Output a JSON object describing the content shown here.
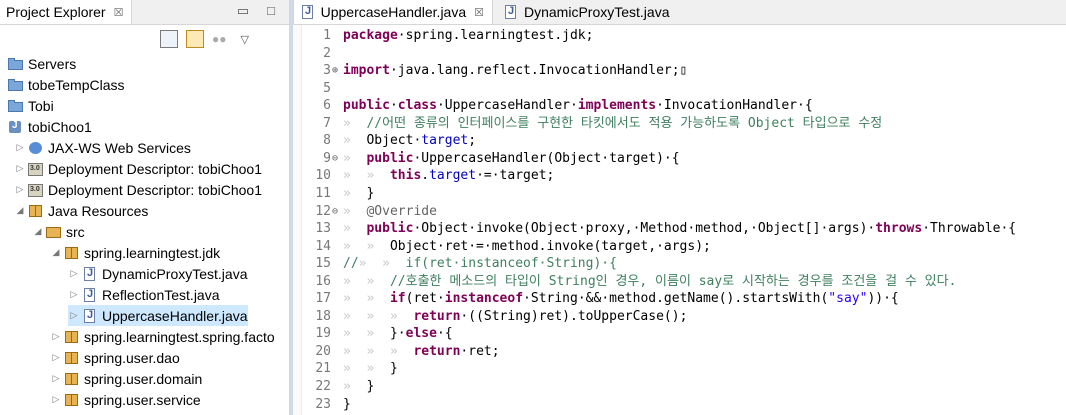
{
  "project_explorer": {
    "tab_title": "Project Explorer",
    "close_glyph": "☒",
    "minimize_glyph": "▭",
    "maximize_glyph": "□",
    "tree": [
      {
        "label": "Servers",
        "icon": "folder-icon",
        "indent": 0,
        "toggle": ""
      },
      {
        "label": "tobeTempClass",
        "icon": "folder-icon",
        "indent": 0,
        "toggle": ""
      },
      {
        "label": "Tobi",
        "icon": "folder-icon",
        "indent": 0,
        "toggle": ""
      },
      {
        "label": "tobiChoo1",
        "icon": "project-icon",
        "indent": 0,
        "toggle": ""
      },
      {
        "label": "JAX-WS Web Services",
        "icon": "web-services-icon",
        "indent": 1,
        "toggle": "▷"
      },
      {
        "label": "Deployment Descriptor: tobiChoo1",
        "icon": "deployment-descriptor-icon",
        "indent": 1,
        "toggle": "▷"
      },
      {
        "label": "Deployment Descriptor: tobiChoo1",
        "icon": "deployment-descriptor-icon",
        "indent": 1,
        "toggle": "▷"
      },
      {
        "label": "Java Resources",
        "icon": "java-resources-icon",
        "indent": 1,
        "toggle": "◢"
      },
      {
        "label": "src",
        "icon": "source-folder-icon",
        "indent": 2,
        "toggle": "◢"
      },
      {
        "label": "spring.learningtest.jdk",
        "icon": "package-icon",
        "indent": 3,
        "toggle": "◢"
      },
      {
        "label": "DynamicProxyTest.java",
        "icon": "java-file-icon",
        "indent": 4,
        "toggle": "▷"
      },
      {
        "label": "ReflectionTest.java",
        "icon": "java-file-icon",
        "indent": 4,
        "toggle": "▷"
      },
      {
        "label": "UppercaseHandler.java",
        "icon": "java-file-icon",
        "indent": 4,
        "toggle": "▷",
        "selected": true
      },
      {
        "label": "spring.learningtest.spring.facto",
        "icon": "package-icon",
        "indent": 3,
        "toggle": "▷"
      },
      {
        "label": "spring.user.dao",
        "icon": "package-icon",
        "indent": 3,
        "toggle": "▷"
      },
      {
        "label": "spring.user.domain",
        "icon": "package-icon",
        "indent": 3,
        "toggle": "▷"
      },
      {
        "label": "spring.user.service",
        "icon": "package-icon",
        "indent": 3,
        "toggle": "▷"
      }
    ]
  },
  "editor": {
    "tabs": [
      {
        "label": "UppercaseHandler.java",
        "active": true,
        "close_glyph": "☒"
      },
      {
        "label": "DynamicProxyTest.java",
        "active": false
      }
    ],
    "lines": [
      {
        "n": "1",
        "fold": "",
        "segs": [
          [
            "kw",
            "package"
          ],
          [
            "",
            "·spring.learningtest.jdk;"
          ]
        ]
      },
      {
        "n": "2",
        "fold": "",
        "segs": []
      },
      {
        "n": "3",
        "fold": "⊕",
        "segs": [
          [
            "kw",
            "import"
          ],
          [
            "",
            "·java.lang.reflect.InvocationHandler;▯"
          ]
        ]
      },
      {
        "n": "5",
        "fold": "",
        "segs": []
      },
      {
        "n": "6",
        "fold": "",
        "segs": [
          [
            "kw",
            "public"
          ],
          [
            "",
            "·"
          ],
          [
            "kw",
            "class"
          ],
          [
            "",
            "·UppercaseHandler·"
          ],
          [
            "kw",
            "implements"
          ],
          [
            "",
            "·InvocationHandler·{"
          ]
        ]
      },
      {
        "n": "7",
        "fold": "",
        "segs": [
          [
            "ws",
            "»  "
          ],
          [
            "cm",
            "//어떤 종류의 인터페이스를 구현한 타킷에서도 적용 가능하도록 Object 타입으로 수정"
          ]
        ]
      },
      {
        "n": "8",
        "fold": "",
        "segs": [
          [
            "ws",
            "»  "
          ],
          [
            "",
            "Object·"
          ],
          [
            "fld",
            "target"
          ],
          [
            "",
            ";"
          ]
        ]
      },
      {
        "n": "9",
        "fold": "⊖",
        "segs": [
          [
            "ws",
            "»  "
          ],
          [
            "kw",
            "public"
          ],
          [
            "",
            "·UppercaseHandler(Object·target)·{"
          ]
        ]
      },
      {
        "n": "10",
        "fold": "",
        "segs": [
          [
            "ws",
            "»  »  "
          ],
          [
            "kw",
            "this"
          ],
          [
            "",
            "."
          ],
          [
            "fld",
            "target"
          ],
          [
            "",
            "·=·target;"
          ]
        ]
      },
      {
        "n": "11",
        "fold": "",
        "segs": [
          [
            "ws",
            "»  "
          ],
          [
            "",
            "}"
          ]
        ]
      },
      {
        "n": "12",
        "fold": "⊖",
        "segs": [
          [
            "ws",
            "»  "
          ],
          [
            "ann",
            "@Override"
          ]
        ]
      },
      {
        "n": "13",
        "fold": "",
        "segs": [
          [
            "ws",
            "»  "
          ],
          [
            "kw",
            "public"
          ],
          [
            "",
            "·Object·invoke(Object·proxy,·Method·method,·Object[]·args)·"
          ],
          [
            "kw",
            "throws"
          ],
          [
            "",
            "·Throwable·{"
          ]
        ]
      },
      {
        "n": "14",
        "fold": "",
        "segs": [
          [
            "ws",
            "»  »  "
          ],
          [
            "",
            "Object·ret·=·method.invoke(target,·args);"
          ]
        ]
      },
      {
        "n": "15",
        "fold": "",
        "segs": [
          [
            "cm",
            "//"
          ],
          [
            "ws",
            "»  »  "
          ],
          [
            "cm",
            "if(ret·instanceof·String)·{"
          ]
        ]
      },
      {
        "n": "16",
        "fold": "",
        "segs": [
          [
            "ws",
            "»  »  "
          ],
          [
            "cm",
            "//호출한 메소드의 타입이 String인 경우, 이름이 say로 시작하는 경우를 조건을 걸 수 있다."
          ]
        ]
      },
      {
        "n": "17",
        "fold": "",
        "segs": [
          [
            "ws",
            "»  »  "
          ],
          [
            "kw",
            "if"
          ],
          [
            "",
            "(ret·"
          ],
          [
            "kw",
            "instanceof"
          ],
          [
            "",
            "·String·&&·method.getName().startsWith("
          ],
          [
            "str",
            "\"say\""
          ],
          [
            "",
            "))·{"
          ]
        ]
      },
      {
        "n": "18",
        "fold": "",
        "segs": [
          [
            "ws",
            "»  »  »  "
          ],
          [
            "kw",
            "return"
          ],
          [
            "",
            "·((String)ret).toUpperCase();"
          ]
        ]
      },
      {
        "n": "19",
        "fold": "",
        "segs": [
          [
            "ws",
            "»  »  "
          ],
          [
            "",
            "}·"
          ],
          [
            "kw",
            "else"
          ],
          [
            "",
            "·{"
          ]
        ]
      },
      {
        "n": "20",
        "fold": "",
        "segs": [
          [
            "ws",
            "»  »  »  "
          ],
          [
            "kw",
            "return"
          ],
          [
            "",
            "·ret;"
          ]
        ]
      },
      {
        "n": "21",
        "fold": "",
        "segs": [
          [
            "ws",
            "»  »  "
          ],
          [
            "",
            "}"
          ]
        ]
      },
      {
        "n": "22",
        "fold": "",
        "segs": [
          [
            "ws",
            "»  "
          ],
          [
            "",
            "}"
          ]
        ]
      },
      {
        "n": "23",
        "fold": "",
        "segs": [
          [
            "",
            "}"
          ]
        ]
      }
    ]
  }
}
